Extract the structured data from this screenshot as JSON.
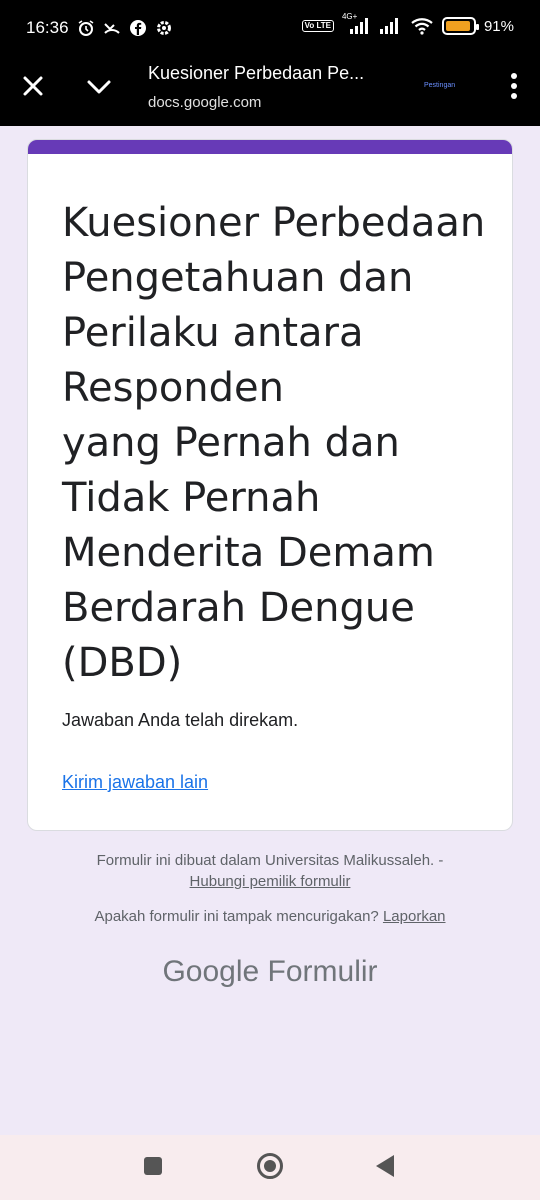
{
  "status_bar": {
    "time": "16:36",
    "network": "4G+",
    "volte": "Vo LTE",
    "battery_percent": "91%",
    "battery_level": 0.91,
    "icons": [
      "alarm-icon",
      "missed-call-icon",
      "facebook-icon",
      "settings-icon",
      "signal-icon",
      "wifi-icon",
      "battery-icon"
    ]
  },
  "toolbar": {
    "title": "Kuesioner Perbedaan Pe...",
    "url": "docs.google.com",
    "small_label": "Pestingan"
  },
  "form": {
    "title_lines": [
      "Kuesioner Perbedaan",
      "Pengetahuan dan",
      "Perilaku antara",
      "Responden",
      "yang Pernah dan",
      "Tidak Pernah",
      "Menderita Demam",
      "Berdarah Dengue",
      "(DBD)"
    ],
    "confirmation": "Jawaban Anda telah direkam.",
    "submit_another": "Kirim jawaban lain",
    "accent_color": "#673ab7"
  },
  "footer": {
    "created_by": "Formulir ini dibuat dalam Universitas Malikussaleh. -",
    "contact_owner": "Hubungi pemilik formulir",
    "suspicious_question": "Apakah formulir ini tampak mencurigakan?",
    "report": "Laporkan",
    "brand_google": "Google",
    "brand_product": "Formulir"
  }
}
